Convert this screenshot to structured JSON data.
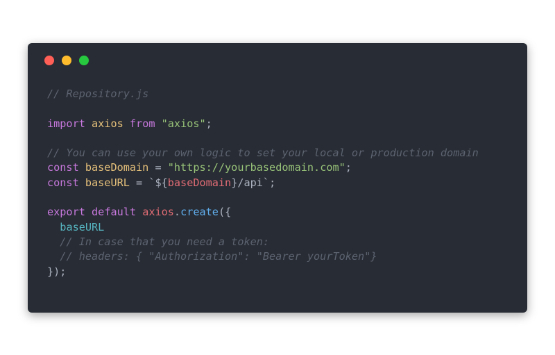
{
  "colors": {
    "background": "#ffffff",
    "editor_bg": "#282c34",
    "dot_close": "#ff5f56",
    "dot_minimize": "#ffbd2e",
    "dot_maximize": "#27c93f",
    "comment": "#5c6370",
    "keyword": "#c678dd",
    "variable": "#e5c07b",
    "string": "#98c379",
    "punct": "#abb2bf",
    "interp": "#e06c75",
    "func": "#61afef",
    "prop": "#56b6c2"
  },
  "code_lines": [
    [
      {
        "t": "// Repository.js",
        "c": "comment"
      }
    ],
    [],
    [
      {
        "t": "import",
        "c": "keyword"
      },
      {
        "t": " ",
        "c": "punct"
      },
      {
        "t": "axios",
        "c": "variable"
      },
      {
        "t": " ",
        "c": "punct"
      },
      {
        "t": "from",
        "c": "keyword"
      },
      {
        "t": " ",
        "c": "punct"
      },
      {
        "t": "\"axios\"",
        "c": "string"
      },
      {
        "t": ";",
        "c": "punct"
      }
    ],
    [],
    [
      {
        "t": "// You can use your own logic to set your local or production domain",
        "c": "comment"
      }
    ],
    [
      {
        "t": "const",
        "c": "keyword"
      },
      {
        "t": " ",
        "c": "punct"
      },
      {
        "t": "baseDomain",
        "c": "variable"
      },
      {
        "t": " = ",
        "c": "punct"
      },
      {
        "t": "\"https://yourbasedomain.com\"",
        "c": "string"
      },
      {
        "t": ";",
        "c": "punct"
      }
    ],
    [
      {
        "t": "const",
        "c": "keyword"
      },
      {
        "t": " ",
        "c": "punct"
      },
      {
        "t": "baseURL",
        "c": "variable"
      },
      {
        "t": " = ",
        "c": "punct"
      },
      {
        "t": "`${",
        "c": "punct"
      },
      {
        "t": "baseDomain",
        "c": "interp"
      },
      {
        "t": "}/api`",
        "c": "punct"
      },
      {
        "t": ";",
        "c": "punct"
      }
    ],
    [],
    [
      {
        "t": "export",
        "c": "keyword"
      },
      {
        "t": " ",
        "c": "punct"
      },
      {
        "t": "default",
        "c": "keyword"
      },
      {
        "t": " ",
        "c": "punct"
      },
      {
        "t": "axios",
        "c": "interp"
      },
      {
        "t": ".",
        "c": "punct"
      },
      {
        "t": "create",
        "c": "func"
      },
      {
        "t": "({",
        "c": "punct"
      }
    ],
    [
      {
        "t": "  ",
        "c": "punct"
      },
      {
        "t": "baseURL",
        "c": "prop"
      }
    ],
    [
      {
        "t": "  ",
        "c": "punct"
      },
      {
        "t": "// In case that you need a token:",
        "c": "comment"
      }
    ],
    [
      {
        "t": "  ",
        "c": "punct"
      },
      {
        "t": "// headers: { \"Authorization\": \"Bearer yourToken\"}",
        "c": "comment"
      }
    ],
    [
      {
        "t": "});",
        "c": "punct"
      }
    ]
  ]
}
